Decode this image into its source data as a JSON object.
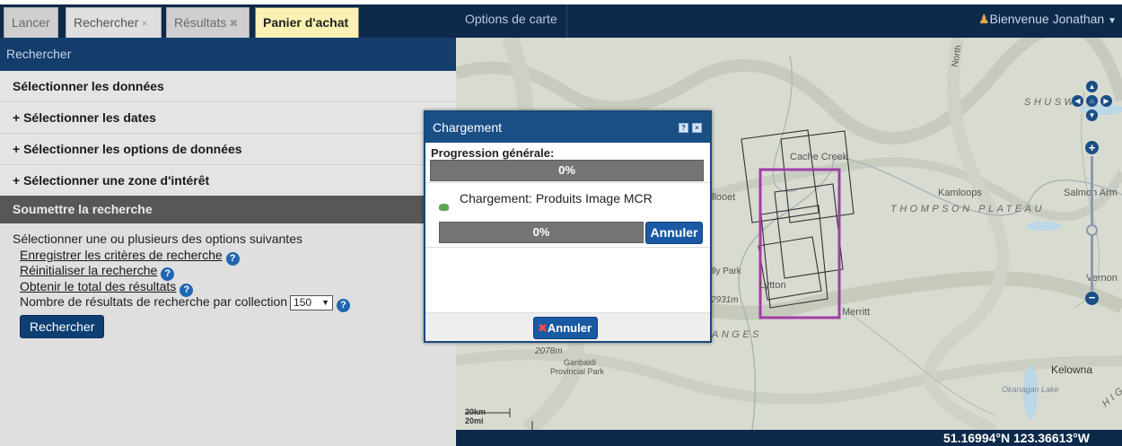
{
  "tabs": [
    {
      "label": "Lancer",
      "closable": false
    },
    {
      "label": "Rechercher",
      "closable": true
    },
    {
      "label": "Résultats",
      "closable": true
    },
    {
      "label": "Panier d'achat",
      "closable": false
    }
  ],
  "search_panel": {
    "header": "Rechercher",
    "sections": [
      "Sélectionner les données",
      "+ Sélectionner les dates",
      "+ Sélectionner les options de données",
      "+ Sélectionner une zone d'intérêt"
    ],
    "submit_header": "Soumettre la recherche",
    "instruction": "Sélectionner une ou plusieurs des options suivantes",
    "links": [
      "Enregistrer les critères de recherche",
      "Réinitialiser la recherche",
      "Obtenir le total des résultats"
    ],
    "results_label": "Nombre de résultats de recherche par collection",
    "results_value": "150",
    "search_button": "Rechercher"
  },
  "map": {
    "options_label": "Options de carte",
    "welcome": "Bienvenue Jonathan",
    "coordinates": "51.16994°N 123.36613°W",
    "labels": {
      "north": "North",
      "cache_creek": "Cache Creek",
      "kamloops": "Kamloops",
      "salmon_arm": "Salmon Arm",
      "thompson": "THOMPSON PLATEAU",
      "shuswap": "SHUSW",
      "lillooet": "llooet",
      "lytton": "Lytton",
      "merritt": "Merritt",
      "vernon": "Vernon",
      "kelowna": "Kelowna",
      "okanagan": "Okanagan Lake",
      "ranges": "ANGES",
      "park": "lly Park",
      "elev1": "2931m",
      "elev2": "2078m",
      "garibaldi": "Garibaldi",
      "garibaldi2": "Provincial Park",
      "high": "HIG",
      "scale_km": "20km",
      "scale_mi": "20mi"
    },
    "colors": {
      "selection": "#a23ea8",
      "footprint": "#333333",
      "water": "#bcd7e6"
    }
  },
  "dialog": {
    "title": "Chargement",
    "overall_label": "Progression générale:",
    "overall_progress": "0%",
    "item_label": "Chargement: Produits Image MCR",
    "item_progress": "0%",
    "item_cancel": "Annuler",
    "footer_cancel": "Annuler",
    "help_icon": "?",
    "close_icon": "×"
  }
}
